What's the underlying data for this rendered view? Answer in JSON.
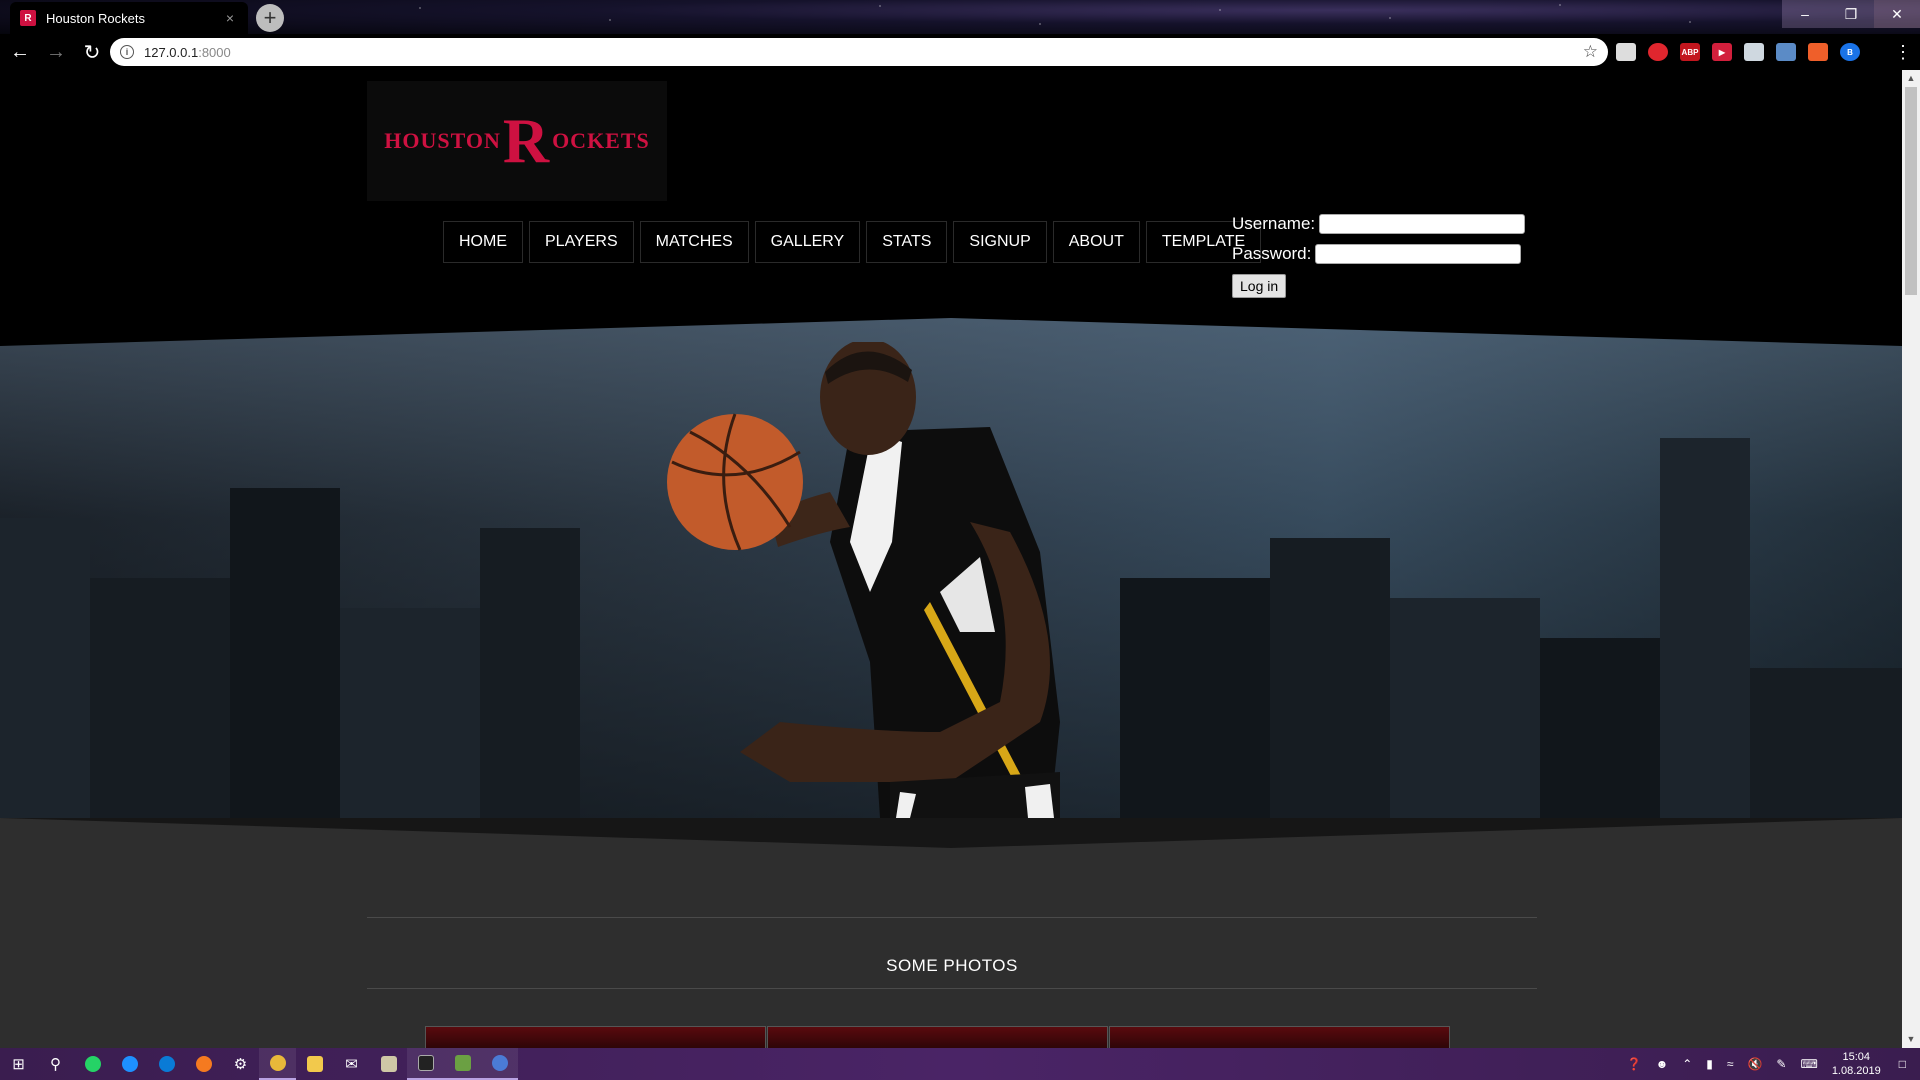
{
  "browser": {
    "tab_title": "Houston Rockets",
    "tab_favicon": "rockets-favicon",
    "tab_close": "×",
    "new_tab": "+",
    "url_host": "127.0.0.1",
    "url_port": ":8000",
    "extensions": [
      "cube-icon",
      "red-shield-icon",
      "abp-icon",
      "red-play-icon",
      "shield-icon",
      "people-icon",
      "orange-square-icon",
      "profile-b-icon"
    ],
    "profile_letter": "B",
    "abp_label": "ABP"
  },
  "site": {
    "logo": {
      "left_text": "HOUSTON",
      "r_letter": "R",
      "right_text": "OCKETS"
    },
    "nav": [
      "HOME",
      "PLAYERS",
      "MATCHES",
      "GALLERY",
      "STATS",
      "SIGNUP",
      "ABOUT",
      "TEMPLATE"
    ],
    "login": {
      "username_label": "Username:",
      "password_label": "Password:",
      "button_label": "Log in",
      "username_value": "",
      "password_value": ""
    },
    "section_title": "SOME PHOTOS",
    "photo_count": 3
  },
  "taskbar": {
    "time": "15:04",
    "date": "1.08.2019",
    "apps": [
      "start-icon",
      "search-icon",
      "whatsapp-icon",
      "ie-icon",
      "edge-icon",
      "firefox-icon",
      "settings-icon",
      "chrome-icon",
      "folder-icon",
      "mail-icon",
      "notepad-icon",
      "terminal-icon",
      "android-studio-icon",
      "app-icon"
    ]
  },
  "colors": {
    "brand_red": "#ce1141",
    "page_bg": "#000000",
    "content_bg": "#2e2e2e",
    "taskbar": "#4a2466"
  }
}
